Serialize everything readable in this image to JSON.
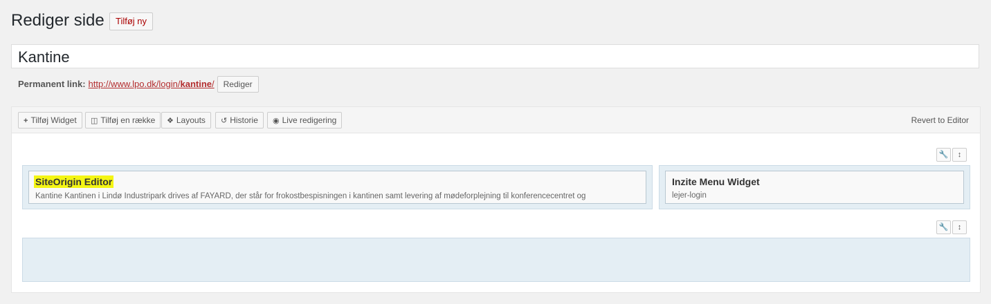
{
  "header": {
    "title": "Rediger side",
    "add_new_label": "Tilføj ny"
  },
  "post": {
    "title_value": "Kantine",
    "permalink_label": "Permanent link:",
    "permalink_base": "http://www.lpo.dk/login/",
    "permalink_slug": "kantine",
    "permalink_trailing": "/",
    "edit_button_label": "Rediger"
  },
  "toolbar": {
    "buttons": [
      {
        "label": "Tilføj Widget",
        "icon": "plus-icon"
      },
      {
        "label": "Tilføj en række",
        "icon": "columns-icon"
      },
      {
        "label": "Layouts",
        "icon": "layouts-icon"
      },
      {
        "label": "Historie",
        "icon": "history-icon"
      },
      {
        "label": "Live redigering",
        "icon": "eye-icon"
      }
    ],
    "revert_label": "Revert to Editor"
  },
  "rows": [
    {
      "widgets": [
        {
          "title": "SiteOrigin Editor",
          "description": "Kantine Kantinen i Lindø Industripark drives af FAYARD, der står for frokostbespisningen i kantinen samt levering af mødeforplejning til konferencecentret og",
          "highlighted": true
        },
        {
          "title": "Inzite Menu Widget",
          "description": "lejer-login",
          "highlighted": false
        }
      ]
    },
    {
      "widgets": []
    }
  ],
  "colors": {
    "accent_red": "#a00",
    "link_red": "#b32d2e",
    "cell_bg": "#e4eef4",
    "highlight": "#f4f514"
  }
}
